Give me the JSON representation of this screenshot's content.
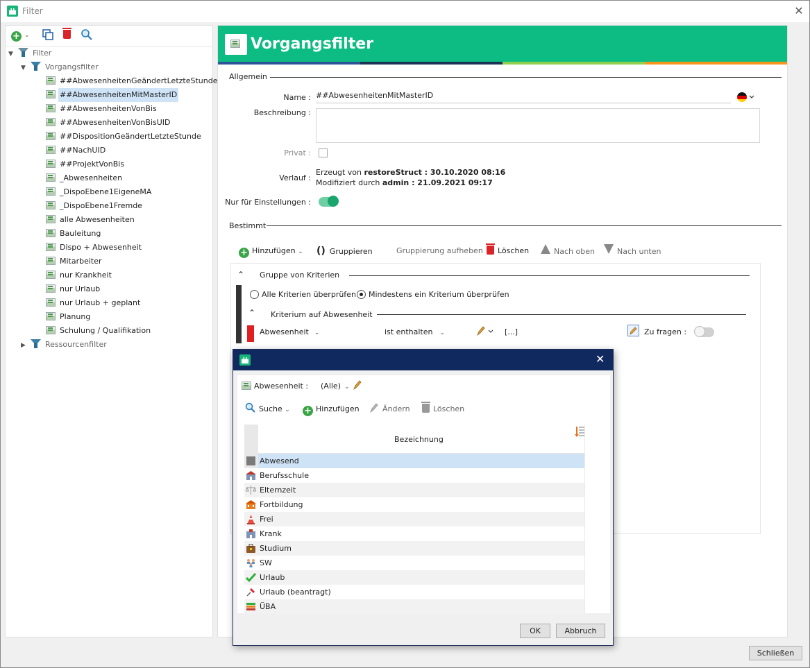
{
  "window": {
    "title": "Filter",
    "close_label": "✕"
  },
  "tree": {
    "root": "Filter",
    "group1": "Vorgangsfilter",
    "items": [
      "##AbwesenheitenGeändertLetzteStunde",
      "##AbwesenheitenMitMasterID",
      "##AbwesenheitenVonBis",
      "##AbwesenheitenVonBisUID",
      "##DispositionGeändertLetzteStunde",
      "##NachUID",
      "##ProjektVonBis",
      "_Abwesenheiten",
      "_DispoEbene1EigeneMA",
      "_DispoEbene1Fremde",
      "alle Abwesenheiten",
      "Bauleitung",
      "Dispo + Abwesenheit",
      "Mitarbeiter",
      "nur Krankheit",
      "nur Urlaub",
      "nur Urlaub + geplant",
      "Planung",
      "Schulung / Qualifikation"
    ],
    "selected_index": 1,
    "group2": "Ressourcenfilter"
  },
  "detail": {
    "title": "Vorgangsfilter",
    "section_general": "Allgemein",
    "name_label": "Name :",
    "name_value": "##AbwesenheitenMitMasterID",
    "description_label": "Beschreibung :",
    "private_label": "Privat :",
    "history_label": "Verlauf :",
    "history_line1_prefix": "Erzeugt von ",
    "history_line1_value": "restoreStruct : 30.10.2020 08:16",
    "history_line2_prefix": "Modifiziert durch ",
    "history_line2_value": "admin : 21.09.2021 09:17",
    "settings_only_label": "Nur für Einstellungen :",
    "settings_only_on": true,
    "section_defined": "Bestimmt"
  },
  "toolbar": {
    "add": "Hinzufügen",
    "group": "Gruppieren",
    "ungroup": "Gruppierung aufheben",
    "delete": "Löschen",
    "up": "Nach oben",
    "down": "Nach unten"
  },
  "criteria": {
    "group_title": "Gruppe von Kriterien",
    "radio_all": "Alle Kriterien überprüfen",
    "radio_any": "Mindestens ein Kriterium überprüfen",
    "selected_radio": "any",
    "criterion_title": "Kriterium auf Abwesenheit",
    "field": "Abwesenheit",
    "operator": "ist enthalten",
    "value": "[...]",
    "ask_label": "Zu fragen :",
    "ask_on": false
  },
  "dialog": {
    "filter_label": "Abwesenheit :",
    "filter_value": "(Alle)",
    "search": "Suche",
    "add": "Hinzufügen",
    "edit": "Ändern",
    "delete": "Löschen",
    "column_header": "Bezeichnung",
    "rows": [
      {
        "label": "Abwesend",
        "icon": "gray-square-icon"
      },
      {
        "label": "Berufsschule",
        "icon": "school-icon"
      },
      {
        "label": "Elternzeit",
        "icon": "scale-icon"
      },
      {
        "label": "Fortbildung",
        "icon": "building-icon"
      },
      {
        "label": "Frei",
        "icon": "traffic-cone-icon"
      },
      {
        "label": "Krank",
        "icon": "hospital-icon"
      },
      {
        "label": "Studium",
        "icon": "briefcase-icon"
      },
      {
        "label": "SW",
        "icon": "people-icon"
      },
      {
        "label": "Urlaub",
        "icon": "checkmark-icon"
      },
      {
        "label": "Urlaub (beantragt)",
        "icon": "pushpin-icon"
      },
      {
        "label": "ÜBA",
        "icon": "books-icon"
      }
    ],
    "selected_row": 0,
    "ok": "OK",
    "cancel": "Abbruch"
  },
  "footer": {
    "close": "Schließen"
  },
  "colors": {
    "header_green": "#0dbc82",
    "stripe": [
      "#2b5597",
      "#1b3456",
      "#8fd14f",
      "#f7941d"
    ],
    "dialog_title": "#10295e",
    "selection": "#cfe3f7",
    "toggle_green": "#1aa56d",
    "criterion_red": "#e02020"
  }
}
